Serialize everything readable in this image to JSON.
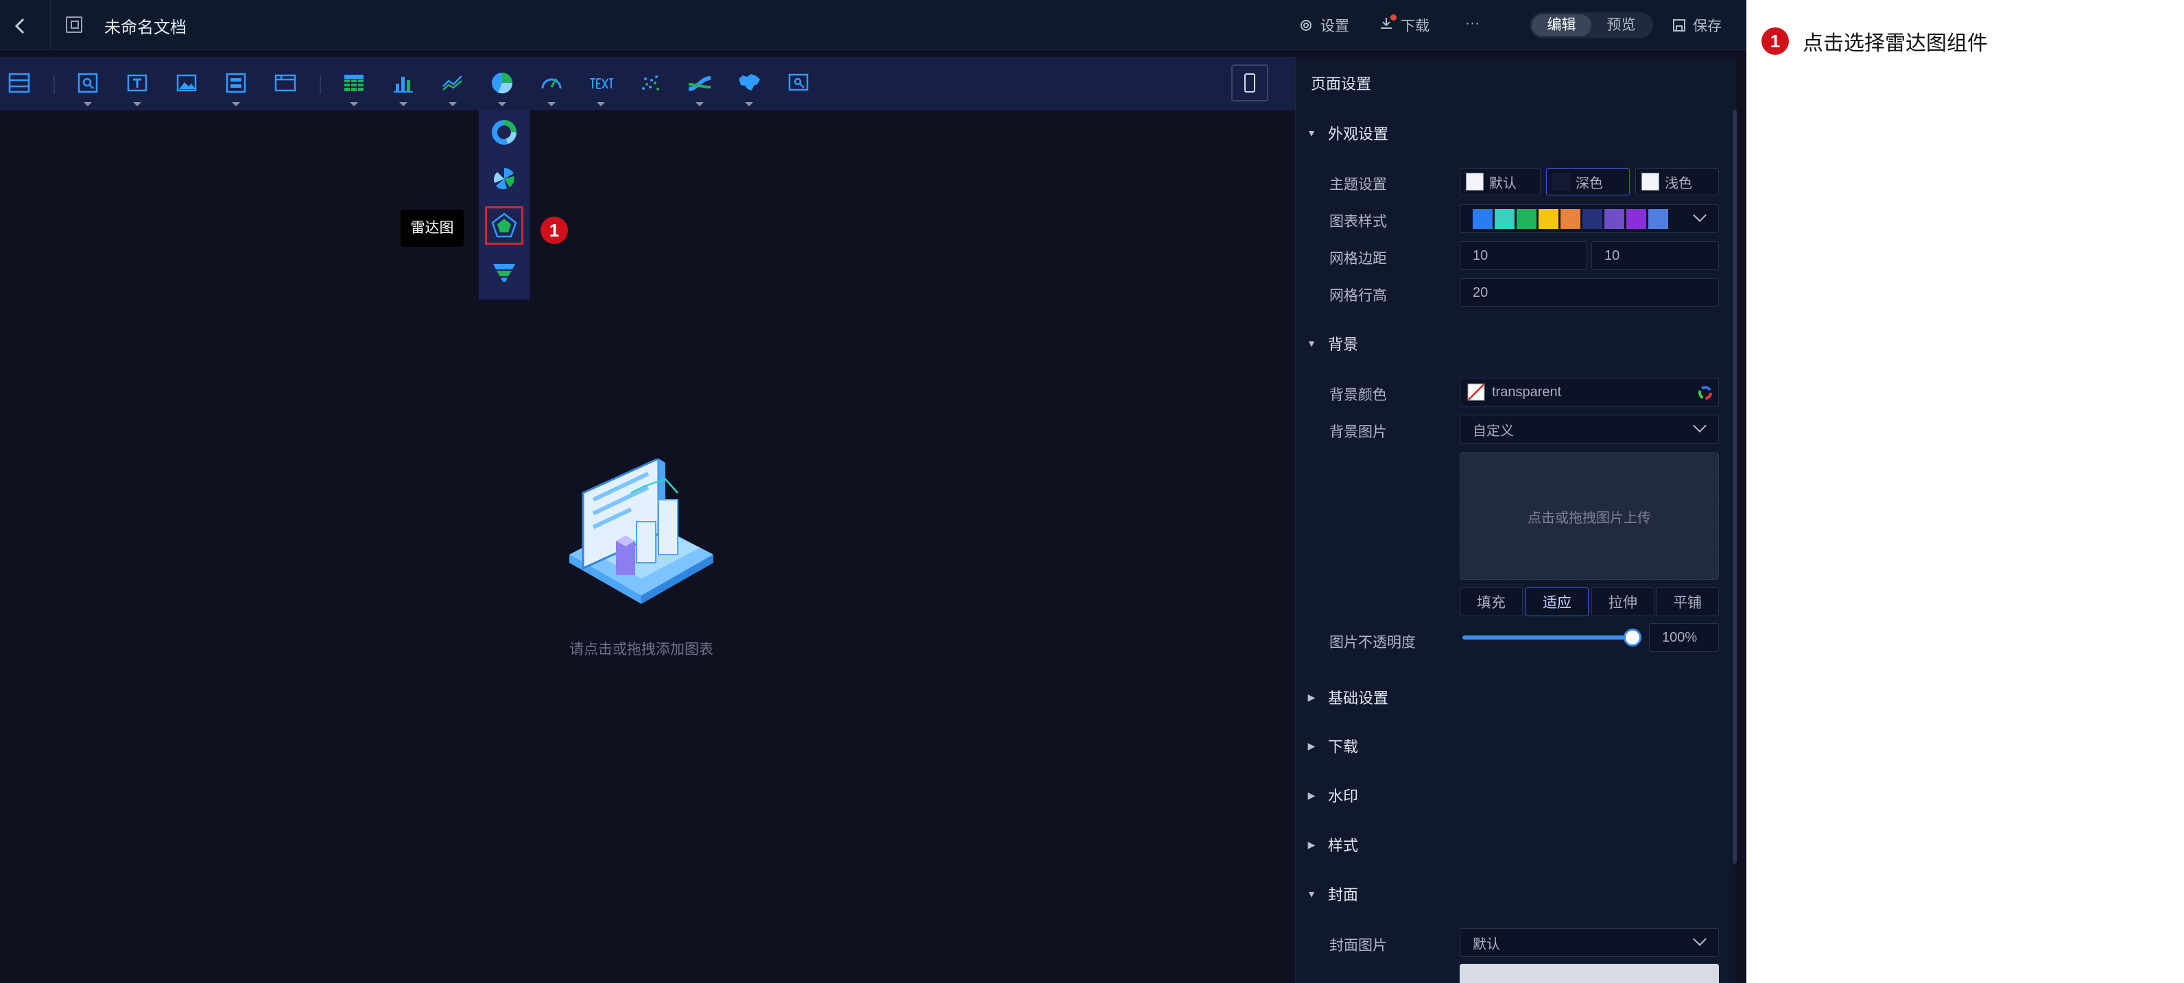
{
  "topbar": {
    "back_icon": "chevron-left-icon",
    "doc_title": "未命名文档",
    "settings_label": "设置",
    "download_label": "下载",
    "more_label": "···",
    "edit_label": "编辑",
    "preview_label": "预览",
    "save_label": "保存"
  },
  "toolbar": {
    "tools": [
      "layout-icon",
      "filter-query-icon",
      "text-icon",
      "image-icon",
      "layout-block-icon",
      "window-icon",
      "table-icon",
      "bar-chart-icon",
      "line-chart-icon",
      "pie-chart-icon",
      "gauge-icon",
      "text-art-icon",
      "scatter-icon",
      "sankey-icon",
      "map-icon",
      "selection-icon"
    ],
    "phone_icon": "mobile-icon"
  },
  "chart_dropdown": {
    "items": [
      "donut-chart-icon",
      "rose-chart-icon",
      "radar-chart-icon",
      "funnel-chart-icon"
    ],
    "selected": "radar-chart-icon",
    "tooltip": "雷达图",
    "step_number": "1"
  },
  "canvas": {
    "empty_text": "请点击或拖拽添加图表"
  },
  "panel": {
    "title": "页面设置",
    "appearance": {
      "section_label": "外观设置",
      "theme_label": "主题设置",
      "theme_options": [
        "默认",
        "深色",
        "浅色"
      ],
      "theme_selected": "深色",
      "chart_style_label": "图表样式",
      "palette": [
        "#2a7cf5",
        "#39d0c0",
        "#1fb35b",
        "#f5c512",
        "#e8823c",
        "#27307a",
        "#6e4fc8",
        "#8a2fd8",
        "#4f7ee0"
      ],
      "grid_margin_label": "网格边距",
      "grid_margin_x": "10",
      "grid_margin_y": "10",
      "grid_row_height_label": "网格行高",
      "grid_row_height": "20"
    },
    "background": {
      "section_label": "背景",
      "color_label": "背景颜色",
      "color_value": "transparent",
      "image_label": "背景图片",
      "image_value": "自定义",
      "upload_text": "点击或拖拽图片上传",
      "fit_options": [
        "填充",
        "适应",
        "拉伸",
        "平铺"
      ],
      "fit_selected": "适应",
      "opacity_label": "图片不透明度",
      "opacity_value": "100%",
      "opacity_level": 1.0
    },
    "collapsed_sections": [
      "基础设置",
      "下载",
      "水印",
      "样式"
    ],
    "cover": {
      "section_label": "封面",
      "image_label": "封面图片",
      "image_value": "默认"
    }
  },
  "annotation": {
    "step_number": "1",
    "text": "点击选择雷达图组件"
  }
}
